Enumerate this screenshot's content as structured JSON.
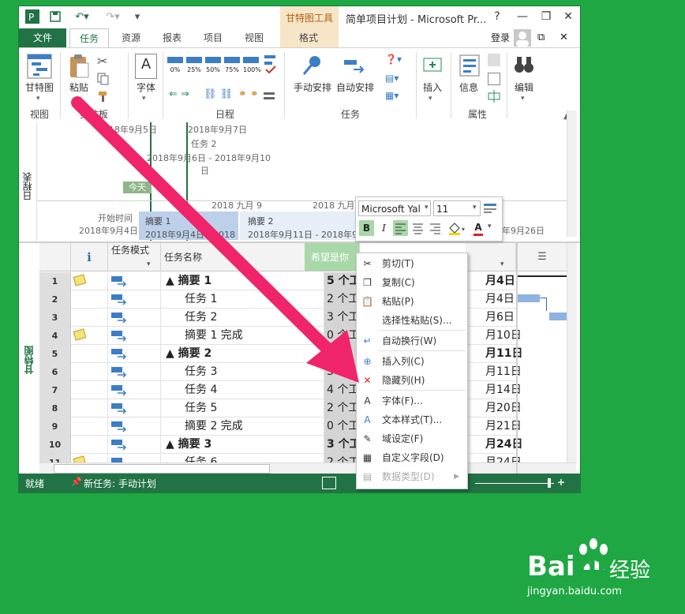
{
  "window": {
    "title": "简单项目计划 - Microsoft Pr...",
    "context_tool": "甘特图工具",
    "controls": {
      "help": "?",
      "minimize": "—",
      "restore": "❐",
      "close": "✕"
    }
  },
  "tabs": {
    "file": "文件",
    "items": [
      "任务",
      "资源",
      "报表",
      "项目",
      "视图"
    ],
    "context_format": "格式",
    "login": "登录"
  },
  "ribbon": {
    "view_btn": "甘特图",
    "paste_btn": "粘贴",
    "font_btn": "字体",
    "pct_labels": [
      "0%",
      "25%",
      "50%",
      "75%",
      "100%"
    ],
    "manual_btn": "手动安排",
    "auto_btn": "自动安排",
    "insert_btn": "插入",
    "info_btn": "信息",
    "edit_btn": "编辑",
    "groups": {
      "view": "视图",
      "clipboard": "剪贴板",
      "schedule": "日程",
      "tasks": "任务",
      "properties": "属性"
    }
  },
  "timeline": {
    "side_label": "日程表",
    "date_a": "2018年9月5日",
    "date_b": "2018年9月7日",
    "task2": "任务 2",
    "task2_range": "2018年9月6日 - 2018年9月10",
    "task2_range_cont": "日",
    "today": "今天",
    "month_1": "2018 九月 9",
    "month_2": "2018 九月",
    "start_label": "开始时间",
    "start_date": "2018年9月4日",
    "summary1": "摘要 1",
    "summary1_range": "2018年9月4日 - 2018",
    "summary2": "摘要 2",
    "summary2_range": "2018年9月11日 - 2018年9月18",
    "end_date": "2018年9月26日"
  },
  "grid": {
    "side_label": "甘特图",
    "col_info": "ℹ",
    "col_mode": "任务模式",
    "col_name": "任务名称",
    "col_dur": "希望是你",
    "rows": [
      {
        "num": "1",
        "note": true,
        "name": "▲ 摘要 1",
        "bold": true,
        "indent": 0,
        "dur": "5 个工作",
        "fin": "月4日"
      },
      {
        "num": "2",
        "note": false,
        "name": "任务 1",
        "bold": false,
        "indent": 1,
        "dur": "2 个工作",
        "fin": "月4日"
      },
      {
        "num": "3",
        "note": false,
        "name": "任务 2",
        "bold": false,
        "indent": 1,
        "dur": "3 个工作",
        "fin": "月6日"
      },
      {
        "num": "4",
        "note": true,
        "name": "摘要 1 完成",
        "bold": false,
        "indent": 1,
        "dur": "0 个工作",
        "fin": "月10日"
      },
      {
        "num": "5",
        "note": false,
        "name": "▲ 摘要 2",
        "bold": true,
        "indent": 0,
        "dur": "",
        "fin": "月11日"
      },
      {
        "num": "6",
        "note": false,
        "name": "任务 3",
        "bold": false,
        "indent": 1,
        "dur": "3 个",
        "fin": "月11日"
      },
      {
        "num": "7",
        "note": false,
        "name": "任务 4",
        "bold": false,
        "indent": 1,
        "dur": "4 个工作",
        "fin": "月14日"
      },
      {
        "num": "8",
        "note": false,
        "name": "任务 5",
        "bold": false,
        "indent": 1,
        "dur": "2 个工作",
        "fin": "月20日"
      },
      {
        "num": "9",
        "note": false,
        "name": "摘要 2 完成",
        "bold": false,
        "indent": 1,
        "dur": "0 个工作",
        "fin": "月21日"
      },
      {
        "num": "10",
        "note": false,
        "name": "▲ 摘要 3",
        "bold": true,
        "indent": 0,
        "dur": "3 个工作",
        "fin": "月24日"
      },
      {
        "num": "11",
        "note": true,
        "name": "任务 6",
        "bold": false,
        "indent": 1,
        "dur": "2 个工作",
        "fin": "月24日"
      }
    ]
  },
  "status": {
    "ready": "就绪",
    "new_task": "新任务: 手动计划"
  },
  "minitoolbar": {
    "font": "Microsoft Yal",
    "size": "11",
    "bold": "B",
    "italic": "I",
    "font_color": "A"
  },
  "context_menu": {
    "items": [
      "剪切(T)",
      "复制(C)",
      "粘贴(P)",
      "选择性粘贴(S)...",
      "自动换行(W)",
      "插入列(C)",
      "隐藏列(H)",
      "字体(F)...",
      "文本样式(T)...",
      "域设定(F)",
      "自定义字段(D)",
      "数据类型(D)"
    ],
    "icons": [
      "scissors-icon",
      "copy-icon",
      "paste-icon",
      "",
      "wrap-icon",
      "insert-column-icon",
      "hide-column-icon",
      "font-icon",
      "text-style-icon",
      "field-settings-icon",
      "custom-field-icon",
      "data-type-icon"
    ]
  },
  "watermark": {
    "brand": "Bai",
    "brand2": "du",
    "cn": "经验",
    "url": "jingyan.baidu.com"
  },
  "colors": {
    "background": "#1fa744",
    "excel_green": "#217346",
    "arrow": "#f0246a",
    "context_tab": "#f6e5c6",
    "selected_col": "#d4d4d4"
  }
}
